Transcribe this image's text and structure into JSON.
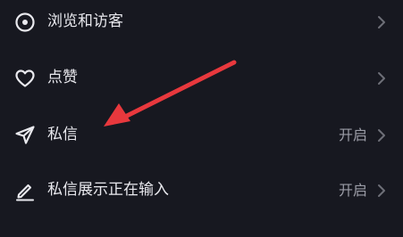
{
  "settings": {
    "items": [
      {
        "label": "浏览和访客",
        "value": "",
        "icon": "eye-icon"
      },
      {
        "label": "点赞",
        "value": "",
        "icon": "heart-icon"
      },
      {
        "label": "私信",
        "value": "开启",
        "icon": "paper-plane-icon"
      },
      {
        "label": "私信展示正在输入",
        "value": "开启",
        "icon": "pencil-icon"
      }
    ]
  },
  "colors": {
    "background": "#171820",
    "text": "#e9e9ee",
    "secondary_text": "#9b9ca6",
    "chevron": "#6e6f78",
    "annotation_arrow": "#e8383d"
  }
}
